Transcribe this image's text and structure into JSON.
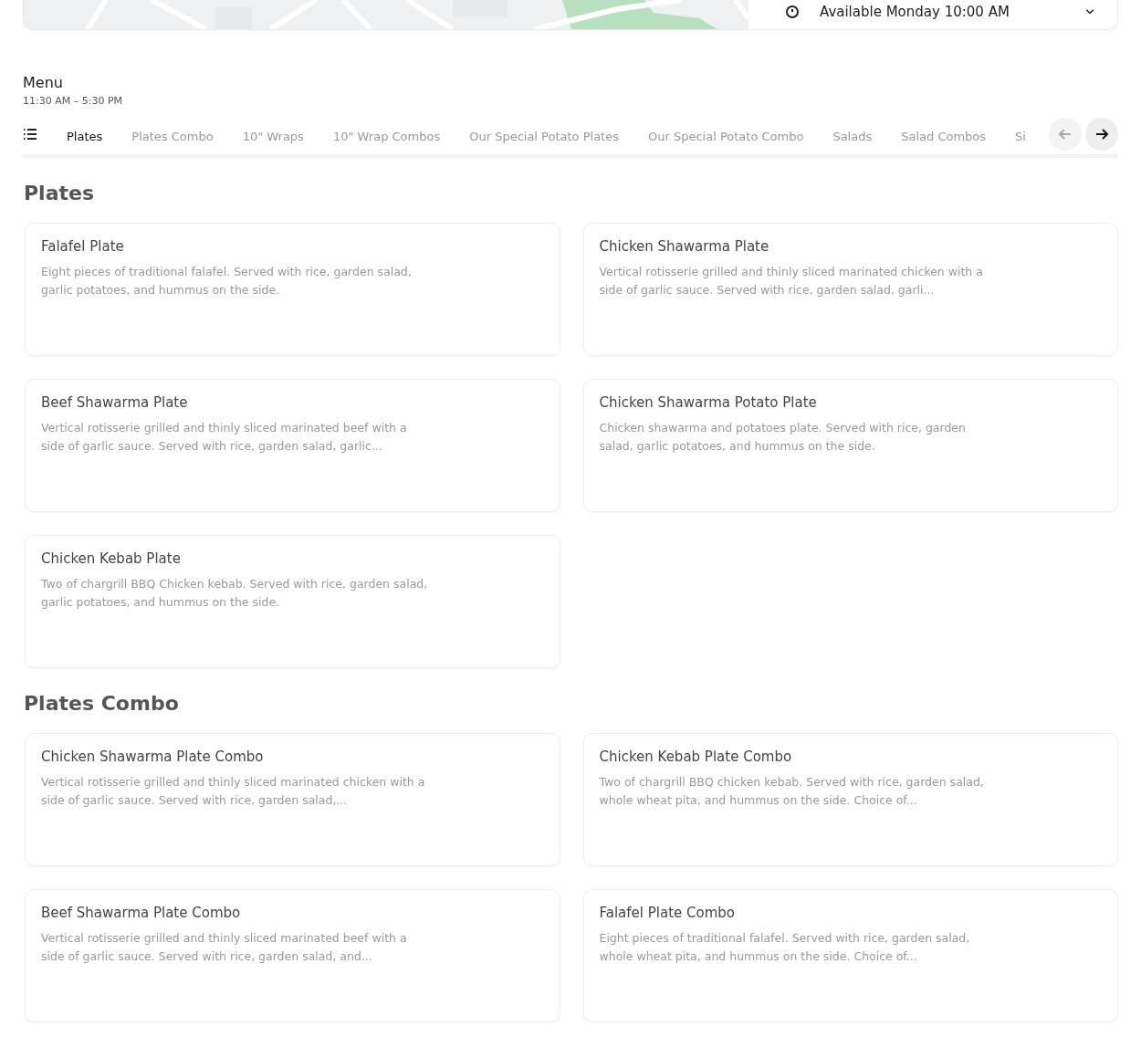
{
  "store": {
    "availability": "Available Monday 10:00 AM"
  },
  "menu": {
    "title": "Menu",
    "hours": "11:30 AM – 5:30 PM"
  },
  "tabs": [
    {
      "label": "Plates",
      "selected": true
    },
    {
      "label": "Plates Combo",
      "selected": false
    },
    {
      "label": "10\" Wraps",
      "selected": false
    },
    {
      "label": "10\" Wrap Combos",
      "selected": false
    },
    {
      "label": "Our Special Potato Plates",
      "selected": false
    },
    {
      "label": "Our Special Potato Combo",
      "selected": false
    },
    {
      "label": "Salads",
      "selected": false
    },
    {
      "label": "Salad Combos",
      "selected": false
    },
    {
      "label": "Si",
      "selected": false
    }
  ],
  "sections": [
    {
      "title": "Plates",
      "items": [
        {
          "name": "Falafel Plate",
          "description": "Eight pieces of traditional falafel. Served with rice, garden salad, garlic potatoes, and hummus on the side."
        },
        {
          "name": "Chicken Shawarma Plate",
          "description": "Vertical rotisserie grilled and thinly sliced marinated chicken with a side of garlic sauce. Served with rice, garden salad, garli..."
        },
        {
          "name": "Beef Shawarma Plate",
          "description": "Vertical rotisserie grilled and thinly sliced marinated beef with a side of garlic sauce. Served with rice, garden salad, garlic..."
        },
        {
          "name": "Chicken Shawarma Potato Plate",
          "description": "Chicken shawarma and potatoes plate. Served with rice, garden salad, garlic potatoes, and hummus on the side."
        },
        {
          "name": "Chicken Kebab Plate",
          "description": "Two of chargrill BBQ Chicken kebab. Served with rice, garden salad, garlic potatoes, and hummus on the side."
        }
      ]
    },
    {
      "title": "Plates Combo",
      "items": [
        {
          "name": "Chicken Shawarma Plate Combo",
          "description": "Vertical rotisserie grilled and thinly sliced marinated chicken with a side of garlic sauce. Served with rice, garden salad,..."
        },
        {
          "name": "Chicken Kebab Plate Combo",
          "description": "Two of chargrill BBQ chicken kebab. Served with rice, garden salad, whole wheat pita, and hummus on the side. Choice of..."
        },
        {
          "name": "Beef Shawarma Plate Combo",
          "description": "Vertical rotisserie grilled and thinly sliced marinated beef with a side of garlic sauce. Served with rice, garden salad, and..."
        },
        {
          "name": "Falafel Plate Combo",
          "description": "Eight pieces of traditional falafel. Served with rice, garden salad, whole wheat pita, and hummus on the side. Choice of..."
        }
      ]
    }
  ]
}
